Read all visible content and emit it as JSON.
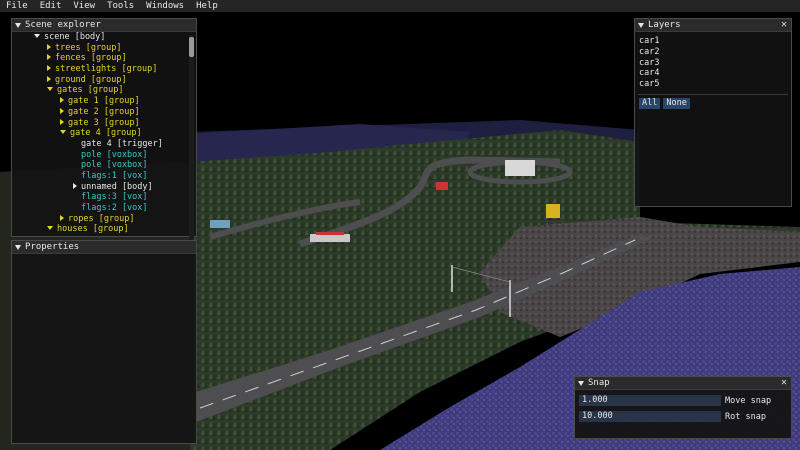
{
  "menu": [
    "File",
    "Edit",
    "View",
    "Tools",
    "Windows",
    "Help"
  ],
  "scene_explorer": {
    "title": "Scene explorer",
    "nodes": [
      {
        "label": "scene [body]",
        "indent": 0,
        "arrow": "down",
        "color": "white"
      },
      {
        "label": "trees [group]",
        "indent": 1,
        "arrow": "right",
        "color": "yellow"
      },
      {
        "label": "fences [group]",
        "indent": 1,
        "arrow": "right",
        "color": "yellow"
      },
      {
        "label": "streetlights [group]",
        "indent": 1,
        "arrow": "right",
        "color": "yellow"
      },
      {
        "label": "ground [group]",
        "indent": 1,
        "arrow": "right",
        "color": "yellow"
      },
      {
        "label": "gates [group]",
        "indent": 1,
        "arrow": "down",
        "color": "yellow"
      },
      {
        "label": "gate 1 [group]",
        "indent": 2,
        "arrow": "right",
        "color": "yellow"
      },
      {
        "label": "gate 2 [group]",
        "indent": 2,
        "arrow": "right",
        "color": "yellow"
      },
      {
        "label": "gate 3 [group]",
        "indent": 2,
        "arrow": "right",
        "color": "yellow"
      },
      {
        "label": "gate 4 [group]",
        "indent": 2,
        "arrow": "down",
        "color": "yellow"
      },
      {
        "label": "gate 4 [trigger]",
        "indent": 3,
        "arrow": "none",
        "color": "white"
      },
      {
        "label": "pole [voxbox]",
        "indent": 3,
        "arrow": "none",
        "color": "cyan"
      },
      {
        "label": "pole [voxbox]",
        "indent": 3,
        "arrow": "none",
        "color": "cyan"
      },
      {
        "label": "flags:1 [vox]",
        "indent": 3,
        "arrow": "none",
        "color": "cyan"
      },
      {
        "label": "unnamed [body]",
        "indent": 3,
        "arrow": "right",
        "color": "white"
      },
      {
        "label": "flags:3 [vox]",
        "indent": 3,
        "arrow": "none",
        "color": "cyan"
      },
      {
        "label": "flags:2 [vox]",
        "indent": 3,
        "arrow": "none",
        "color": "cyan"
      },
      {
        "label": "ropes [group]",
        "indent": 2,
        "arrow": "right",
        "color": "yellow"
      },
      {
        "label": "houses [group]",
        "indent": 1,
        "arrow": "down",
        "color": "yellow"
      }
    ]
  },
  "properties": {
    "title": "Properties"
  },
  "layers": {
    "title": "Layers",
    "items": [
      "car1",
      "car2",
      "car3",
      "car4",
      "car5"
    ],
    "all_label": "All",
    "none_label": "None"
  },
  "snap": {
    "title": "Snap",
    "move_value": "1.000",
    "move_label": "Move snap",
    "rot_value": "10.000",
    "rot_label": "Rot snap"
  },
  "colors": {
    "white": "#e8e8e8",
    "yellow": "#e6d42a",
    "cyan": "#3fc8c8",
    "button": "#29456b",
    "input": "#283447"
  },
  "icons": {
    "collapse": "triangle-down-icon",
    "close": "close-x-icon"
  }
}
